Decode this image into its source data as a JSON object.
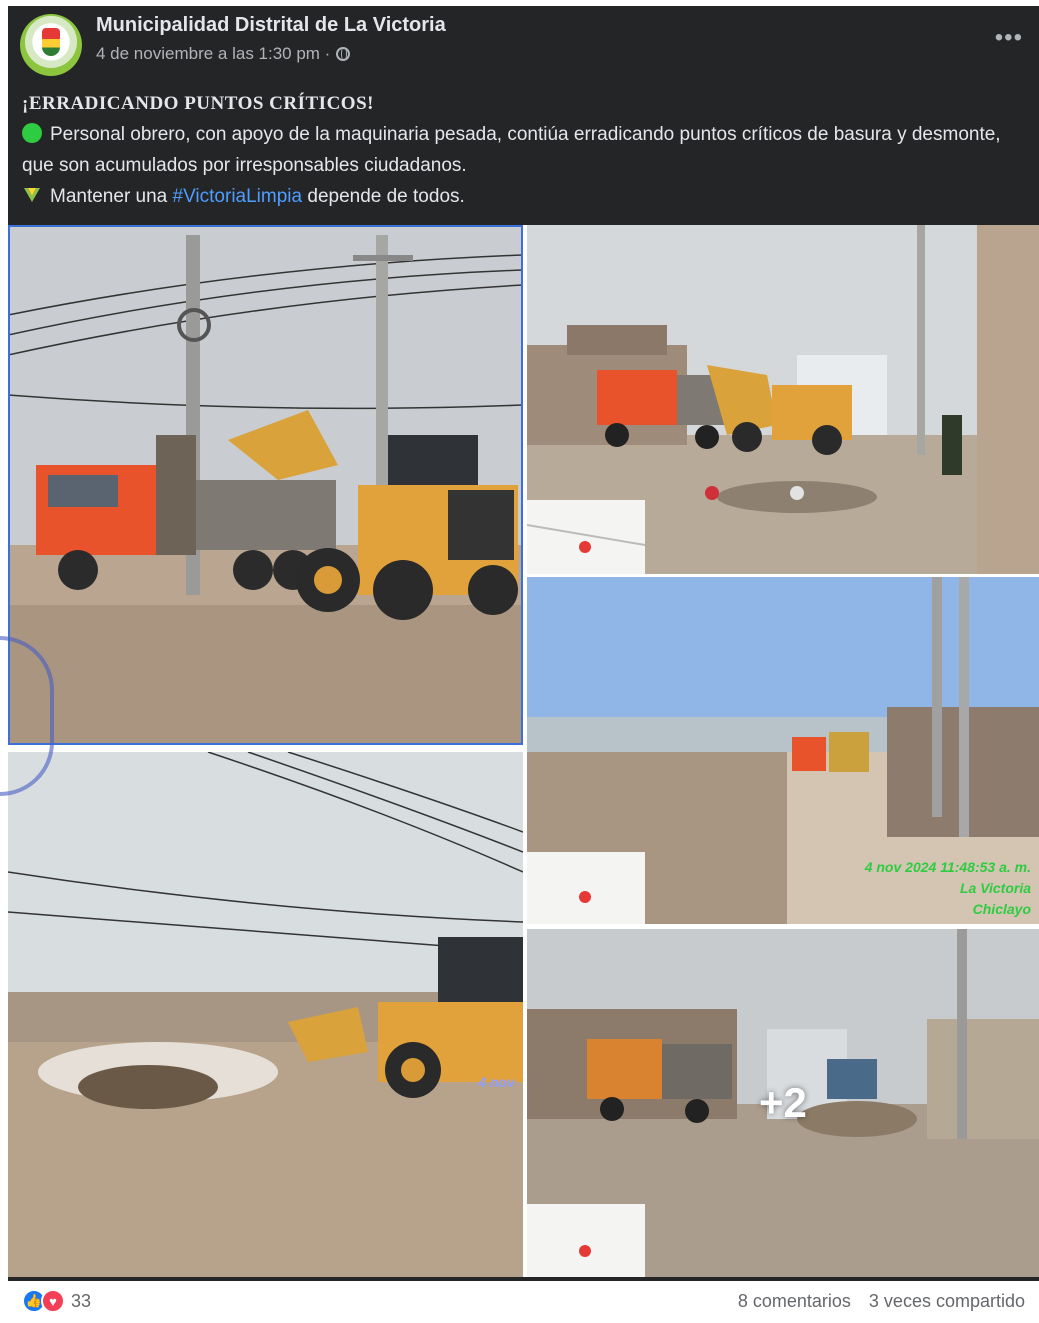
{
  "post": {
    "page_name": "Municipalidad Distrital de La Victoria",
    "timestamp": "4 de noviembre a las 1:30 pm · ",
    "more_icon": "ellipsis-icon",
    "headline": "¡ERRADICANDO PUNTOS CRÍTICOS!",
    "body_line1": "Personal obrero, con apoyo de la maquinaria pesada, contiúa erradicando puntos críticos de basura y desmonte, que son acumulados por irresponsables ciudadanos.",
    "body_line2_before": "Mantener una ",
    "hashtag": "#VictoriaLimpia",
    "body_line2_after": " depende de todos."
  },
  "photos": {
    "photo3_stamp": [
      "4 nov 2024 11:48:53 a. m.",
      "La Victoria",
      "Chiclayo"
    ],
    "photo4_stamp": "4 nov",
    "more_count": "+2"
  },
  "footer": {
    "reaction_count": "33",
    "comments": "8 comentarios",
    "shares": "3 veces compartido"
  },
  "colors": {
    "card_bg": "#242526",
    "text": "#e4e6eb",
    "hashtag": "#4f9dff",
    "stamp_green": "#2ecc40",
    "like_blue": "#1877f2",
    "love_red": "#f33e58"
  }
}
